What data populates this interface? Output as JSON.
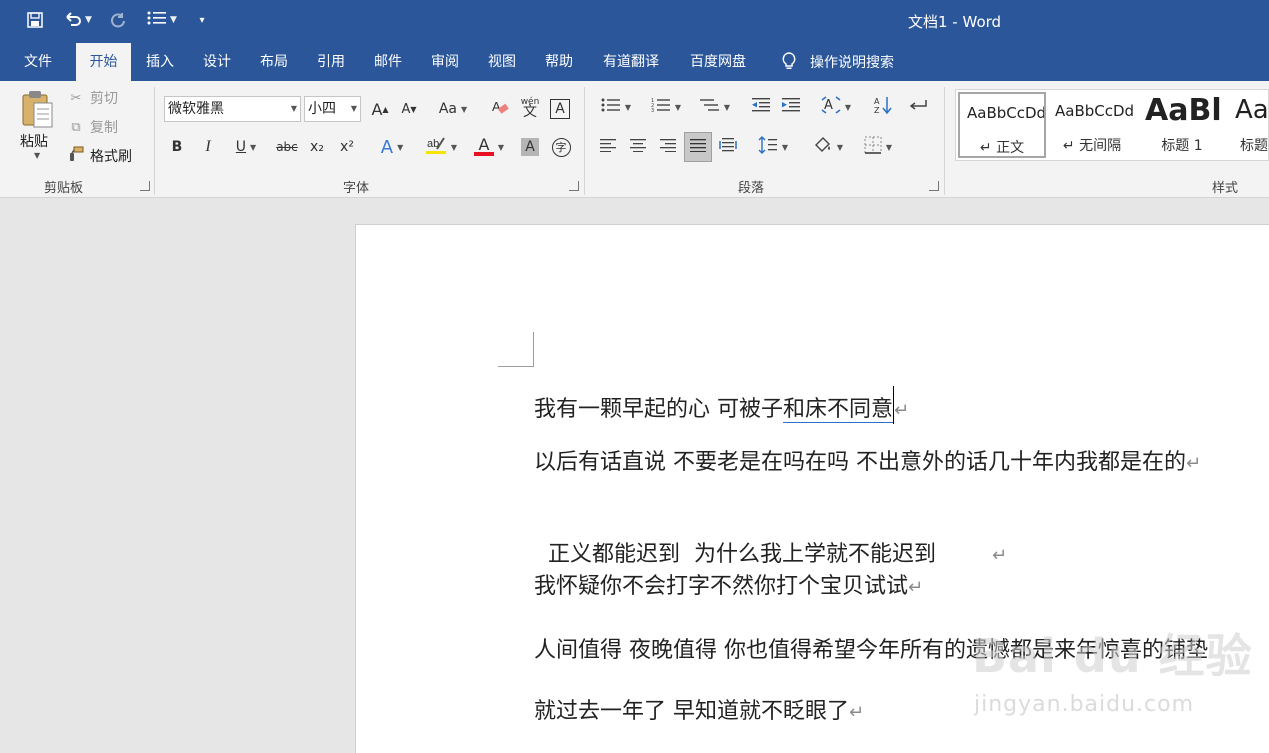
{
  "window": {
    "doc_title": "文档1  -  Word"
  },
  "quick_access": {
    "save_icon": "save-icon",
    "undo_icon": "undo-icon",
    "redo_icon": "redo-icon",
    "bullets_icon": "list-bullets-icon",
    "customize_icon": "customize-toolbar-icon"
  },
  "tabs": [
    "文件",
    "开始",
    "插入",
    "设计",
    "布局",
    "引用",
    "邮件",
    "审阅",
    "视图",
    "帮助",
    "有道翻译",
    "百度网盘"
  ],
  "active_tab": "开始",
  "tell_me": "操作说明搜索",
  "ribbon": {
    "clipboard": {
      "paste": "粘贴",
      "cut": "剪切",
      "copy": "复制",
      "format_painter": "格式刷",
      "label": "剪贴板"
    },
    "font": {
      "font_name": "微软雅黑",
      "font_size": "小四",
      "label": "字体",
      "bold": "B",
      "italic": "I",
      "underline": "U",
      "strikethrough": "abc",
      "subscript": "x₂",
      "superscript": "x²",
      "grow": "A",
      "shrink": "A",
      "change_case": "Aa",
      "font_color": "A",
      "char_shading": "A",
      "text_effect": "A",
      "phonetic": "wén",
      "char_border": "A",
      "enclose": "字",
      "font_color_hex": "#e81123",
      "highlight_hex": "#f5e400"
    },
    "paragraph": {
      "label": "段落"
    },
    "styles": {
      "label": "样式",
      "items": [
        {
          "sample": "AaBbCcDd",
          "name": "↵ 正文"
        },
        {
          "sample": "AaBbCcDd",
          "name": "↵ 无间隔"
        },
        {
          "sample": "AaBl",
          "name": "标题 1"
        },
        {
          "sample": "AaB",
          "name": "标题"
        }
      ]
    }
  },
  "document": {
    "lines": [
      {
        "prefix": "我有一颗早起的心  可被子",
        "underlined": "和床不同意",
        "mark": "↵"
      },
      {
        "text": "以后有话直说  不要老是在吗在吗  不出意外的话几十年内我都是在的",
        "mark": "↵"
      },
      {
        "text": "正义都能迟到  为什么我上学就不能迟到        ",
        "mark": "↵"
      },
      {
        "text": "我怀疑你不会打字不然你打个宝贝试试",
        "mark": "↵"
      },
      {
        "text": "人间值得  夜晚值得  你也值得希望今年所有的遗憾都是来年惊喜的铺垫",
        "mark": ""
      },
      {
        "text": "就过去一年了  早知道就不眨眼了",
        "mark": "↵"
      }
    ]
  },
  "watermark": {
    "main": "Bai du 经验",
    "sub": "jingyan.baidu.com"
  }
}
